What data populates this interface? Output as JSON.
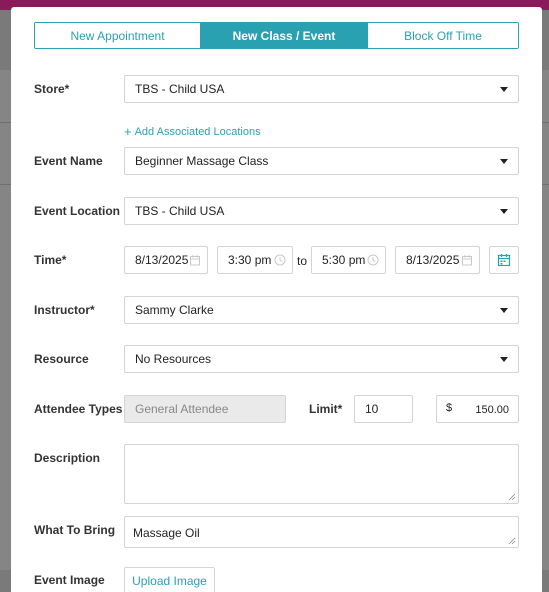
{
  "tabs": [
    {
      "label": "New Appointment",
      "active": false
    },
    {
      "label": "New Class / Event",
      "active": true
    },
    {
      "label": "Block Off Time",
      "active": false
    }
  ],
  "store": {
    "label": "Store*",
    "value": "TBS - Child USA"
  },
  "add_locations_link": "Add Associated Locations",
  "event_name": {
    "label": "Event Name",
    "value": "Beginner Massage Class"
  },
  "event_location": {
    "label": "Event Location",
    "value": "TBS - Child USA"
  },
  "time": {
    "label": "Time*",
    "start_date": "8/13/2025",
    "start_time": "3:30 pm",
    "separator": "to",
    "end_time": "5:30 pm",
    "end_date": "8/13/2025"
  },
  "instructor": {
    "label": "Instructor*",
    "value": "Sammy Clarke"
  },
  "resource": {
    "label": "Resource",
    "value": "No Resources"
  },
  "attendee_types": {
    "label": "Attendee Types",
    "value": "General Attendee"
  },
  "limit": {
    "label": "Limit*",
    "value": "10"
  },
  "price": {
    "currency": "$",
    "value": "150.00"
  },
  "description": {
    "label": "Description",
    "value": ""
  },
  "what_to_bring": {
    "label": "What To Bring",
    "value": "Massage Oil"
  },
  "event_image": {
    "label": "Event Image",
    "button": "Upload Image"
  },
  "colors": {
    "accent": "#2aa1b0",
    "border": "#d4d4d4",
    "brand_bar": "#8a1a5a"
  }
}
